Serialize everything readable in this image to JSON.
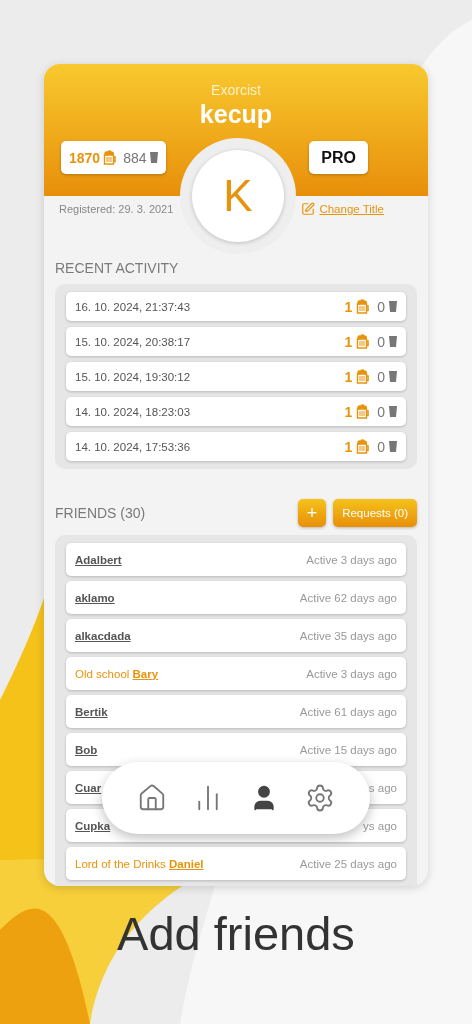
{
  "profile": {
    "title": "Exorcist",
    "username": "kecup",
    "beers": "1870",
    "shots": "884",
    "badge": "PRO",
    "initial": "K",
    "registered": "Registered: 29. 3. 2021",
    "change_title": "Change Title"
  },
  "recent_activity": {
    "heading": "RECENT ACTIVITY",
    "items": [
      {
        "time": "16. 10. 2024, 21:37:43",
        "beers": "1",
        "shots": "0"
      },
      {
        "time": "15. 10. 2024, 20:38:17",
        "beers": "1",
        "shots": "0"
      },
      {
        "time": "15. 10. 2024, 19:30:12",
        "beers": "1",
        "shots": "0"
      },
      {
        "time": "14. 10. 2024, 18:23:03",
        "beers": "1",
        "shots": "0"
      },
      {
        "time": "14. 10. 2024, 17:53:36",
        "beers": "1",
        "shots": "0"
      }
    ]
  },
  "friends": {
    "heading": "FRIENDS (30)",
    "add_button": "+",
    "requests_button": "Requests (0)",
    "items": [
      {
        "name": "Adalbert",
        "active": "Active 3 days ago"
      },
      {
        "name": "aklamo",
        "active": "Active 62 days ago"
      },
      {
        "name": "alkacdada",
        "active": "Active 35 days ago"
      },
      {
        "title": "Old school",
        "name": "Bary",
        "active": "Active 3 days ago"
      },
      {
        "name": "Bertik",
        "active": "Active 61 days ago"
      },
      {
        "name": "Bob",
        "active": "Active 15 days ago"
      },
      {
        "name": "Cuar",
        "active": "s ago"
      },
      {
        "name": "Cupka",
        "active": "ys ago"
      },
      {
        "title": "Lord of the Drinks",
        "name": "Daniel",
        "active": "Active 25 days ago"
      }
    ]
  },
  "nav": [
    {
      "kind": "home",
      "selected": false
    },
    {
      "kind": "stats",
      "selected": false
    },
    {
      "kind": "profile",
      "selected": true
    },
    {
      "kind": "settings",
      "selected": false
    }
  ],
  "headline": "Add friends"
}
